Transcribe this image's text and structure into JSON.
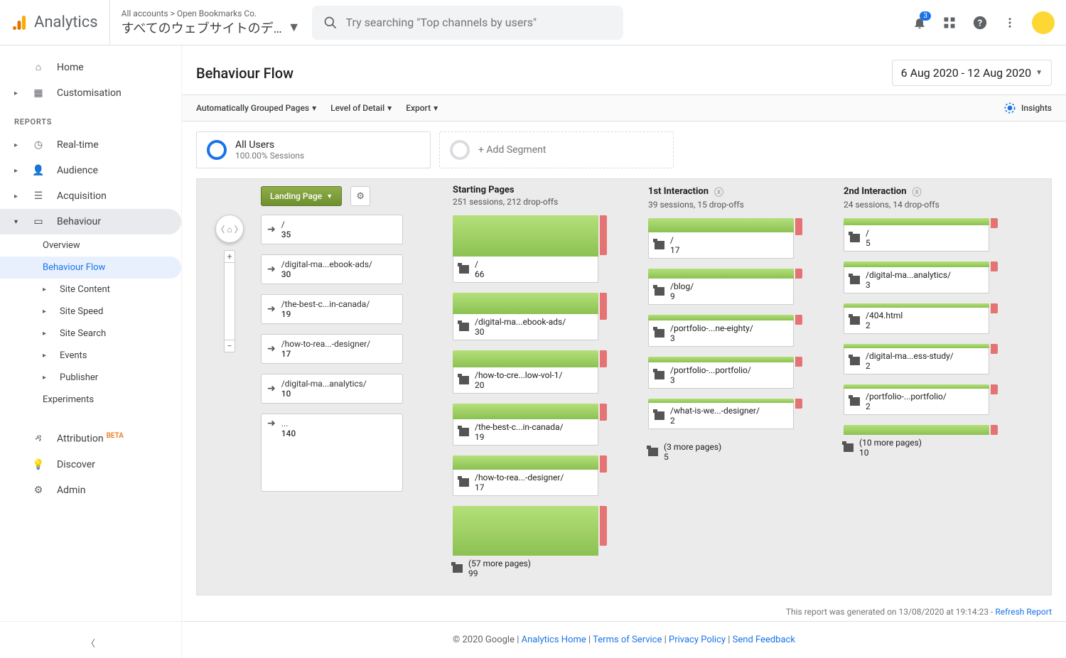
{
  "header": {
    "product": "Analytics",
    "acc_path": "All accounts > Open Bookmarks Co.",
    "acc_view": "すべてのウェブサイトのデ…",
    "search_placeholder": "Try searching \"Top channels by users\"",
    "badge": "3"
  },
  "nav": {
    "home": "Home",
    "custom": "Customisation",
    "reports": "REPORTS",
    "realtime": "Real-time",
    "audience": "Audience",
    "acquisition": "Acquisition",
    "behaviour": "Behaviour",
    "overview": "Overview",
    "bflow": "Behaviour Flow",
    "sitecontent": "Site Content",
    "sitespeed": "Site Speed",
    "sitesearch": "Site Search",
    "events": "Events",
    "publisher": "Publisher",
    "experiments": "Experiments",
    "attribution": "Attribution",
    "beta": "BETA",
    "discover": "Discover",
    "admin": "Admin"
  },
  "page": {
    "title": "Behaviour Flow",
    "date": "6 Aug 2020 - 12 Aug 2020",
    "tb_pages": "Automatically Grouped Pages",
    "tb_detail": "Level of Detail",
    "tb_export": "Export",
    "tb_insights": "Insights",
    "seg_all_title": "All Users",
    "seg_all_sub": "100.00% Sessions",
    "seg_add": "+ Add Segment",
    "dim": "Landing Page",
    "gen_prefix": "This report was generated on 13/08/2020 at 19:14:23 - ",
    "gen_link": "Refresh Report"
  },
  "flow": {
    "landing": [
      {
        "label": "/",
        "count": "35"
      },
      {
        "label": "/digital-ma...ebook-ads/",
        "count": "30"
      },
      {
        "label": "/the-best-c...in-canada/",
        "count": "19"
      },
      {
        "label": "/how-to-rea...-designer/",
        "count": "17"
      },
      {
        "label": "/digital-ma...analytics/",
        "count": "10"
      },
      {
        "label": "...",
        "count": "140",
        "tall": true
      }
    ],
    "cols": [
      {
        "title": "Starting Pages",
        "sub": "251 sessions, 212 drop-offs",
        "nodes": [
          {
            "label": "/",
            "count": "66",
            "bar": "h66",
            "drop": "big"
          },
          {
            "label": "/digital-ma...ebook-ads/",
            "count": "30",
            "bar": "h30",
            "drop": "med"
          },
          {
            "label": "/how-to-cre...low-vol-1/",
            "count": "20",
            "bar": "h20",
            "drop": "sm"
          },
          {
            "label": "/the-best-c...in-canada/",
            "count": "19",
            "bar": "h19",
            "drop": "sm"
          },
          {
            "label": "/how-to-rea...-designer/",
            "count": "17",
            "bar": "h17",
            "drop": "sm"
          },
          {
            "label": "(57 more pages)",
            "count": "99",
            "bar": "h99",
            "drop": "big",
            "more": true
          }
        ]
      },
      {
        "title": "1st Interaction",
        "sub": "39 sessions, 15 drop-offs",
        "close": true,
        "nodes": [
          {
            "label": "/",
            "count": "17",
            "bar": "h17",
            "drop": "sm"
          },
          {
            "label": "/blog/",
            "count": "9",
            "bar": "h9",
            "drop": "xs"
          },
          {
            "label": "/portfolio-...ne-eighty/",
            "count": "3",
            "bar": "h3",
            "drop": "xs"
          },
          {
            "label": "/portfolio-...portfolio/",
            "count": "3",
            "bar": "h3",
            "drop": "xs"
          },
          {
            "label": "/what-is-we...-designer/",
            "count": "2",
            "bar": "h2",
            "drop": "xs"
          },
          {
            "label": "(3 more pages)",
            "count": "5",
            "more": true
          }
        ]
      },
      {
        "title": "2nd Interaction",
        "sub": "24 sessions, 14 drop-offs",
        "close": true,
        "nodes": [
          {
            "label": "/",
            "count": "5",
            "bar": "h5",
            "drop": "xs"
          },
          {
            "label": "/digital-ma...analytics/",
            "count": "3",
            "bar": "h3",
            "drop": "xs"
          },
          {
            "label": "/404.html",
            "count": "2",
            "bar": "h2",
            "drop": "xs"
          },
          {
            "label": "/digital-ma...ess-study/",
            "count": "2",
            "bar": "h2",
            "drop": "xs"
          },
          {
            "label": "/portfolio-...portfolio/",
            "count": "2",
            "bar": "h2",
            "drop": "xs"
          },
          {
            "label": "(10 more pages)",
            "count": "10",
            "bar": "h9",
            "drop": "xs",
            "more": true
          }
        ]
      }
    ]
  },
  "footer": {
    "copy": "© 2020 Google",
    "home": "Analytics Home",
    "terms": "Terms of Service",
    "privacy": "Privacy Policy",
    "feedback": "Send Feedback"
  }
}
